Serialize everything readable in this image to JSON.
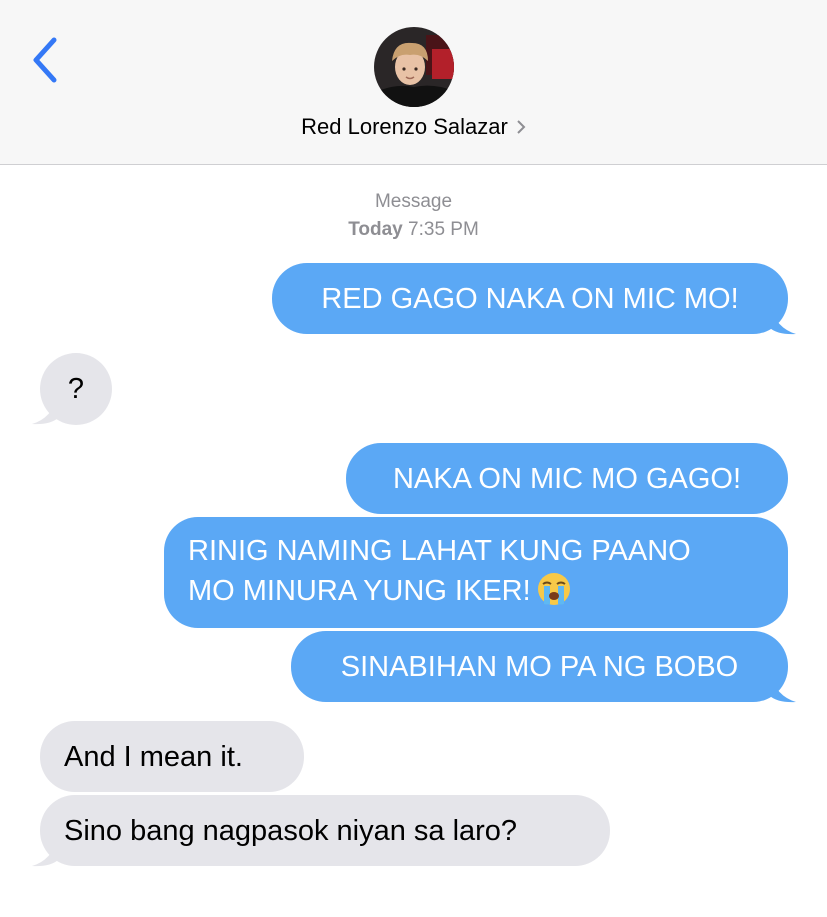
{
  "header": {
    "contact_name": "Red Lorenzo Salazar",
    "back_icon": "chevron-left-icon",
    "accent_color": "#3478f6"
  },
  "conversation": {
    "service": "Message",
    "date_label": "Today",
    "time": "7:35 PM"
  },
  "messages": [
    {
      "from": "me",
      "text": "RED GAGO NAKA ON MIC MO!"
    },
    {
      "from": "them",
      "text": "?"
    },
    {
      "from": "me",
      "text": "NAKA ON MIC MO GAGO!"
    },
    {
      "from": "me",
      "lines": [
        "RINIG NAMING LAHAT KUNG PAANO",
        "MO MINURA YUNG IKER!"
      ],
      "emoji": "loudly-crying-face-icon"
    },
    {
      "from": "me",
      "text": "SINABIHAN MO PA NG BOBO"
    },
    {
      "from": "them",
      "text": "And I mean it."
    },
    {
      "from": "them",
      "text": "Sino bang nagpasok niyan sa laro?"
    }
  ],
  "colors": {
    "sent_bubble": "#5ba8f5",
    "received_bubble": "#e5e5ea",
    "header_bg": "#f7f7f7"
  }
}
